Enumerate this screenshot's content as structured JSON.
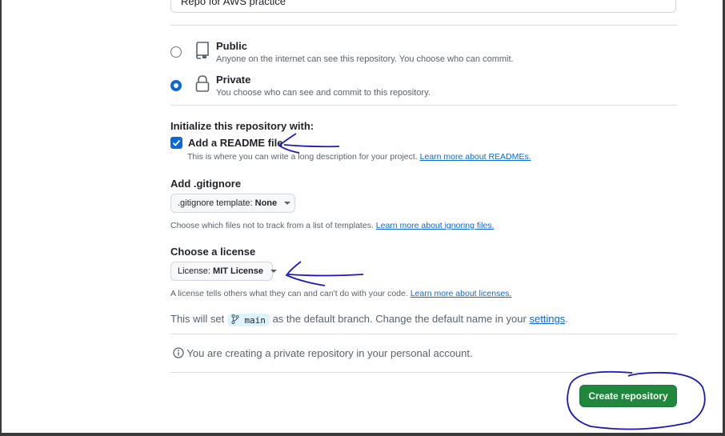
{
  "description_field": {
    "value": "Repo for AWS practice"
  },
  "visibility": {
    "options": [
      {
        "title": "Public",
        "description": "Anyone on the internet can see this repository. You choose who can commit.",
        "selected": false,
        "icon": "repo-icon"
      },
      {
        "title": "Private",
        "description": "You choose who can see and commit to this repository.",
        "selected": true,
        "icon": "lock-icon"
      }
    ]
  },
  "initialize": {
    "title": "Initialize this repository with:",
    "readme": {
      "label": "Add a README file",
      "checked": true,
      "hint": "This is where you can write a long description for your project.",
      "link": "Learn more about READMEs."
    }
  },
  "gitignore": {
    "title": "Add .gitignore",
    "dropdown_prefix": ".gitignore template:",
    "dropdown_value": "None",
    "hint": "Choose which files not to track from a list of templates.",
    "link": "Learn more about ignoring files."
  },
  "license": {
    "title": "Choose a license",
    "dropdown_prefix": "License:",
    "dropdown_value": "MIT License",
    "hint": "A license tells others what they can and can't do with your code.",
    "link": "Learn more about licenses."
  },
  "branch": {
    "prefix": "This will set",
    "name": "main",
    "middle": "as the default branch. Change the default name in your",
    "link": "settings",
    "suffix": "."
  },
  "info": {
    "text": "You are creating a private repository in your personal account."
  },
  "create_button": {
    "label": "Create repository"
  },
  "colors": {
    "accent": "#0969da",
    "primary_button": "#1f883d",
    "annotation_ink": "#1a1ab8"
  }
}
